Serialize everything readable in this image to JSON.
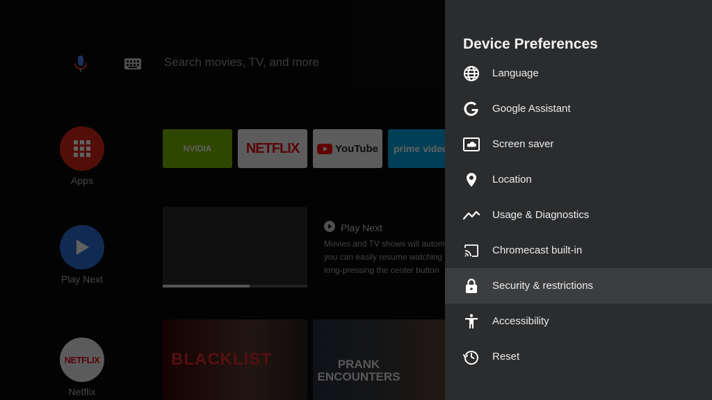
{
  "home": {
    "search_placeholder": "Search movies, TV, and more",
    "rail": [
      {
        "label": "Apps"
      },
      {
        "label": "Play Next"
      },
      {
        "label": "Netflix",
        "badge_text": "NETFLIX"
      }
    ],
    "app_row": [
      {
        "label": "NVIDIA"
      },
      {
        "label": "NETFLIX"
      },
      {
        "label": "YouTube"
      },
      {
        "label": "prime video"
      }
    ],
    "play_next": {
      "title": "Play Next",
      "description": "Movies and TV shows will autom\nyou can easily resume watching\nlong-pressing the center button"
    },
    "thumbnails": [
      {
        "title": "BLACKLIST"
      },
      {
        "title": "PRANK ENCOUNTERS"
      }
    ]
  },
  "panel": {
    "title": "Device Preferences",
    "items": [
      {
        "label": "Language",
        "icon": "globe-icon"
      },
      {
        "label": "Google Assistant",
        "icon": "google-g-icon"
      },
      {
        "label": "Screen saver",
        "icon": "screen-saver-icon"
      },
      {
        "label": "Location",
        "icon": "location-pin-icon"
      },
      {
        "label": "Usage & Diagnostics",
        "icon": "trend-line-icon"
      },
      {
        "label": "Chromecast built-in",
        "icon": "cast-icon"
      },
      {
        "label": "Security & restrictions",
        "icon": "lock-icon",
        "selected": true
      },
      {
        "label": "Accessibility",
        "icon": "accessibility-icon"
      },
      {
        "label": "Reset",
        "icon": "history-icon"
      }
    ]
  },
  "colors": {
    "panel_bg": "#2b2c2e",
    "selected_bg": "#3c3d3f",
    "netflix_red": "#e50914",
    "youtube_red": "#ff0000",
    "nvidia_green": "#76b900",
    "prime_blue": "#00a8e1"
  }
}
